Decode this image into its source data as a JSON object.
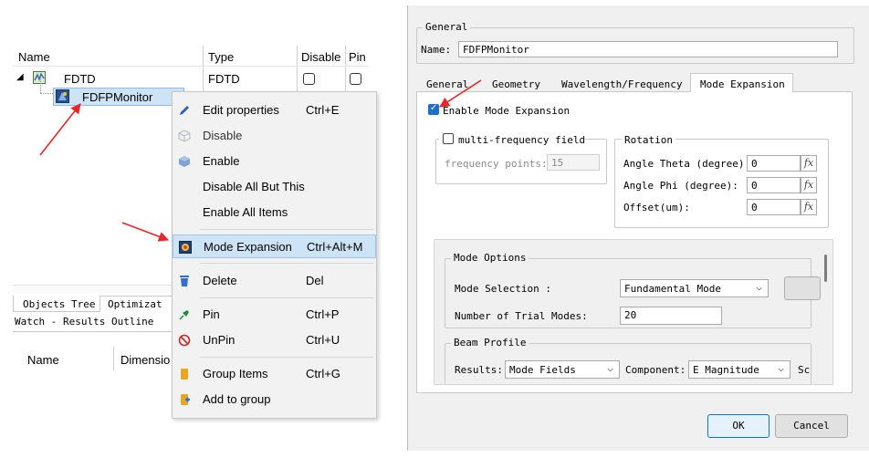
{
  "tree": {
    "headers": {
      "name": "Name",
      "type": "Type",
      "disable": "Disable",
      "pin": "Pin"
    },
    "rows": [
      {
        "name": "FDTD",
        "type": "FDTD",
        "expander": "◢"
      },
      {
        "name": "FDFPMonitor"
      }
    ],
    "bottom_tabs": [
      "Objects Tree",
      "Optimizat"
    ],
    "watch_title": "Watch - Results Outline",
    "watch_headers": {
      "name": "Name",
      "dimension": "Dimensio"
    }
  },
  "context_menu": {
    "items": [
      {
        "label": "Edit properties",
        "shortcut": "Ctrl+E",
        "icon": "pencil-icon"
      },
      {
        "label": "Disable",
        "shortcut": "",
        "icon": "cube-outline-icon"
      },
      {
        "label": "Enable",
        "shortcut": "",
        "icon": "cube-icon"
      },
      {
        "label": "Disable All But This",
        "shortcut": ""
      },
      {
        "label": "Enable All Items",
        "shortcut": ""
      },
      {
        "label": "Mode Expansion",
        "shortcut": "Ctrl+Alt+M",
        "icon": "mode-expansion-icon"
      },
      {
        "label": "Delete",
        "shortcut": "Del",
        "icon": "trash-icon"
      },
      {
        "label": "Pin",
        "shortcut": "Ctrl+P",
        "icon": "pin-icon"
      },
      {
        "label": "UnPin",
        "shortcut": "Ctrl+U",
        "icon": "unpin-icon"
      },
      {
        "label": "Group Items",
        "shortcut": "Ctrl+G",
        "icon": "group-icon"
      },
      {
        "label": "Add to group",
        "shortcut": "",
        "icon": "add-to-group-icon"
      }
    ]
  },
  "dialog": {
    "general_title": "General",
    "name_label": "Name:",
    "name_value": "FDFPMonitor",
    "tabs": [
      "General",
      "Geometry",
      "Wavelength/Frequency",
      "Mode Expansion"
    ],
    "active_tab": "Mode Expansion",
    "enable_label": "Enable Mode Expansion",
    "multi_freq_label": "multi-frequency field",
    "freq_points_label": "frequency points:",
    "freq_points_value": "15",
    "rotation": {
      "title": "Rotation",
      "theta_label": "Angle Theta (degree):",
      "theta_value": "0",
      "phi_label": "Angle Phi (degree):",
      "phi_value": "0",
      "offset_label": "Offset(um):",
      "offset_value": "0",
      "fx": "fx"
    },
    "mode_options": {
      "title": "Mode Options",
      "selection_label": "Mode Selection :",
      "selection_value": "Fundamental Mode",
      "trials_label": "Number of Trial Modes:",
      "trials_value": "20"
    },
    "beam_profile": {
      "title": "Beam Profile",
      "results_label": "Results:",
      "results_value": "Mode Fields",
      "component_label": "Component:",
      "component_value": "E Magnitude",
      "trailing": "Sc"
    },
    "ok_label": "OK",
    "cancel_label": "Cancel"
  },
  "colors": {
    "arrow": "#e8262a",
    "highlight": "#cde4f7",
    "accent": "#1e6ecf"
  }
}
